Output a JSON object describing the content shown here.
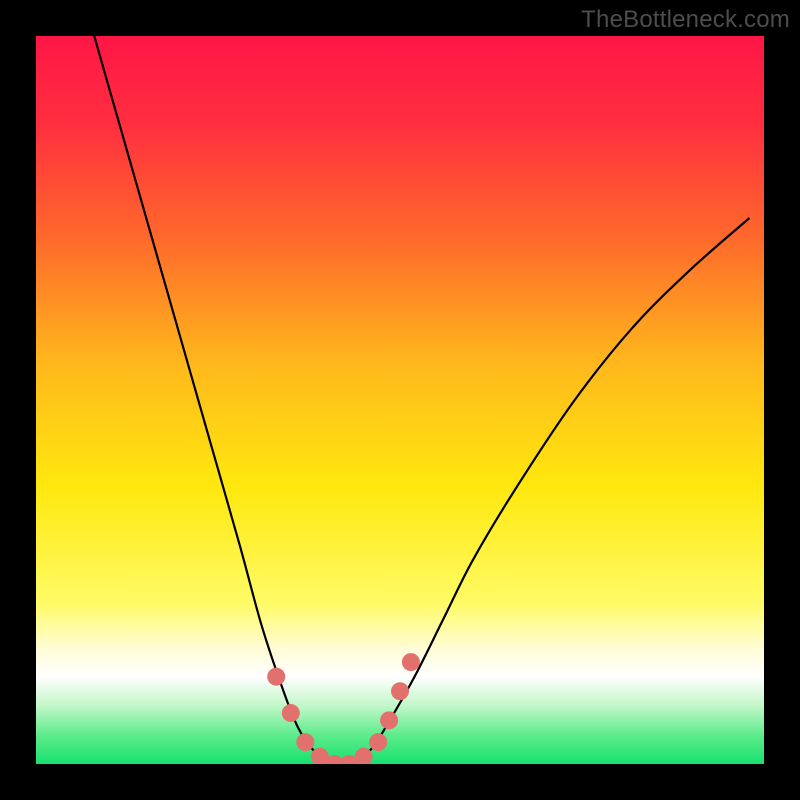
{
  "watermark": "TheBottleneck.com",
  "colors": {
    "frame": "#000000",
    "curve": "#000000",
    "markers": "#e2716e",
    "baseline": "#18e06e",
    "gradient_stops": [
      {
        "offset": 0.0,
        "color": "#ff1646"
      },
      {
        "offset": 0.12,
        "color": "#ff2e3f"
      },
      {
        "offset": 0.28,
        "color": "#ff6a2b"
      },
      {
        "offset": 0.45,
        "color": "#ffb81c"
      },
      {
        "offset": 0.62,
        "color": "#ffe80e"
      },
      {
        "offset": 0.78,
        "color": "#fffb66"
      },
      {
        "offset": 0.84,
        "color": "#fffcd4"
      },
      {
        "offset": 0.88,
        "color": "#ffffff"
      },
      {
        "offset": 0.92,
        "color": "#c2f7c9"
      },
      {
        "offset": 0.96,
        "color": "#5eec8c"
      },
      {
        "offset": 1.0,
        "color": "#18e06e"
      }
    ]
  },
  "chart_data": {
    "type": "line",
    "title": "",
    "xlabel": "",
    "ylabel": "",
    "xlim": [
      0,
      100
    ],
    "ylim": [
      0,
      100
    ],
    "grid": false,
    "legend": false,
    "series": [
      {
        "name": "bottleneck-curve",
        "x": [
          8,
          12,
          16,
          20,
          24,
          28,
          31,
          34,
          36,
          38,
          40,
          42,
          44,
          46,
          48,
          52,
          56,
          60,
          66,
          74,
          82,
          90,
          98
        ],
        "y": [
          100,
          86,
          72,
          58,
          44,
          30,
          19,
          10,
          5,
          2,
          0.5,
          0,
          0.5,
          2,
          5,
          12,
          20,
          28,
          38,
          50,
          60,
          68,
          75
        ]
      }
    ],
    "markers": {
      "name": "highlight-points",
      "x": [
        33,
        35,
        37,
        39,
        41,
        43,
        45,
        47,
        48.5,
        50,
        51.5
      ],
      "y": [
        12,
        7,
        3,
        1,
        0,
        0,
        1,
        3,
        6,
        10,
        14
      ]
    },
    "baseline_y": 0
  }
}
